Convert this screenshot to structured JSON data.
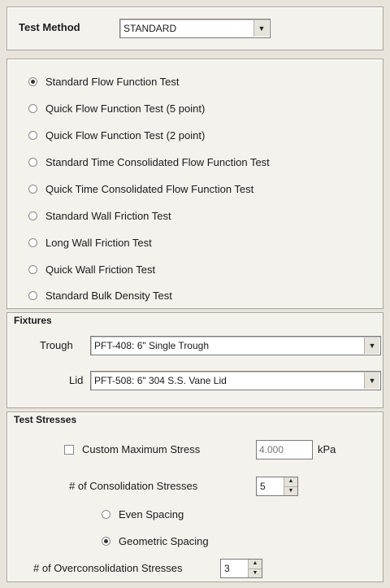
{
  "test_method": {
    "label": "Test Method",
    "selected": "STANDARD",
    "arrow_icon": "▼"
  },
  "tests": [
    {
      "label": "Standard Flow Function Test",
      "selected": true
    },
    {
      "label": "Quick Flow Function Test (5 point)",
      "selected": false
    },
    {
      "label": "Quick Flow Function Test (2 point)",
      "selected": false
    },
    {
      "label": "Standard Time Consolidated Flow Function Test",
      "selected": false
    },
    {
      "label": "Quick Time Consolidated Flow Function Test",
      "selected": false
    },
    {
      "label": "Standard Wall Friction Test",
      "selected": false
    },
    {
      "label": "Long Wall Friction Test",
      "selected": false
    },
    {
      "label": "Quick Wall Friction Test",
      "selected": false
    },
    {
      "label": "Standard Bulk Density Test",
      "selected": false
    }
  ],
  "fixtures": {
    "title": "Fixtures",
    "trough_label": "Trough",
    "trough_value": "PFT-408: 6\" Single Trough",
    "lid_label": "Lid",
    "lid_value": "PFT-508: 6\" 304 S.S. Vane Lid"
  },
  "test_stresses": {
    "title": "Test Stresses",
    "custom_max_label": "Custom Maximum Stress",
    "custom_max_value": "4.000",
    "custom_max_unit": "kPa",
    "consolidation_label": "# of Consolidation Stresses",
    "consolidation_value": "5",
    "even_spacing_label": "Even Spacing",
    "geometric_spacing_label": "Geometric Spacing",
    "overconsolidation_label": "# of Overconsolidation Stresses",
    "overconsolidation_value": "3",
    "up_icon": "▲",
    "down_icon": "▼"
  }
}
